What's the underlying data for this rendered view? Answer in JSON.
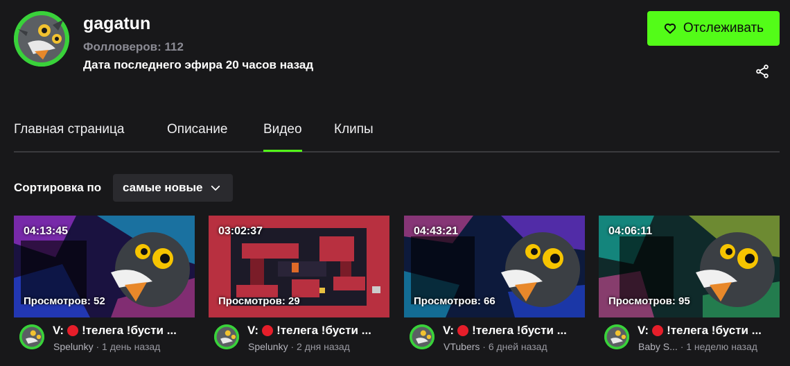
{
  "channel": {
    "name": "gagatun",
    "followers": "Фолловеров: 112",
    "last_stream": "Дата последнего эфира 20 часов назад",
    "avatar_icon": "bird-mascot-avatar"
  },
  "actions": {
    "follow_label": "Отслеживать",
    "follow_icon": "heart-icon",
    "share_icon": "share-icon"
  },
  "tabs": [
    {
      "label": "Главная страница",
      "active": false
    },
    {
      "label": "Описание",
      "active": false
    },
    {
      "label": "Видео",
      "active": true
    },
    {
      "label": "Клипы",
      "active": false
    }
  ],
  "sort": {
    "label": "Сортировка по",
    "selected": "самые новые"
  },
  "videos": [
    {
      "duration": "04:13:45",
      "views": "Просмотров: 52",
      "title_prefix": "V:",
      "title": "!телега !бусти ...",
      "category": "Spelunky",
      "age": "· 1 день назад"
    },
    {
      "duration": "03:02:37",
      "views": "Просмотров: 29",
      "title_prefix": "V:",
      "title": "!телега !бусти ...",
      "category": "Spelunky",
      "age": "· 2 дня назад"
    },
    {
      "duration": "04:43:21",
      "views": "Просмотров: 66",
      "title_prefix": "V:",
      "title": "!телега !бусти ...",
      "category": "VTubers",
      "age": "· 6 дней назад"
    },
    {
      "duration": "04:06:11",
      "views": "Просмотров: 95",
      "title_prefix": "V:",
      "title": "!телега !бусти ...",
      "category": "Baby S...",
      "age": "· 1 неделю назад"
    }
  ],
  "colors": {
    "accent": "#53fc18",
    "background": "#18181a",
    "muted_text": "#8b8b94",
    "live_dot": "#e61e2a"
  }
}
